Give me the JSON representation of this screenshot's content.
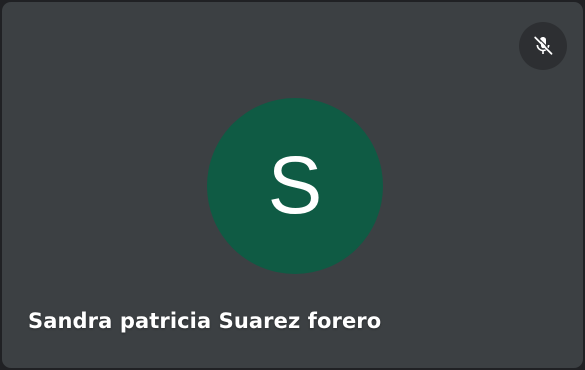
{
  "participant": {
    "name": "Sandra patricia Suarez forero",
    "avatar_initial": "S",
    "avatar_color": "#0f5b44",
    "muted": true,
    "mute_icon": "mic-off-icon"
  },
  "colors": {
    "tile_background": "#3c4043",
    "page_background": "#202124",
    "text": "#ffffff"
  }
}
